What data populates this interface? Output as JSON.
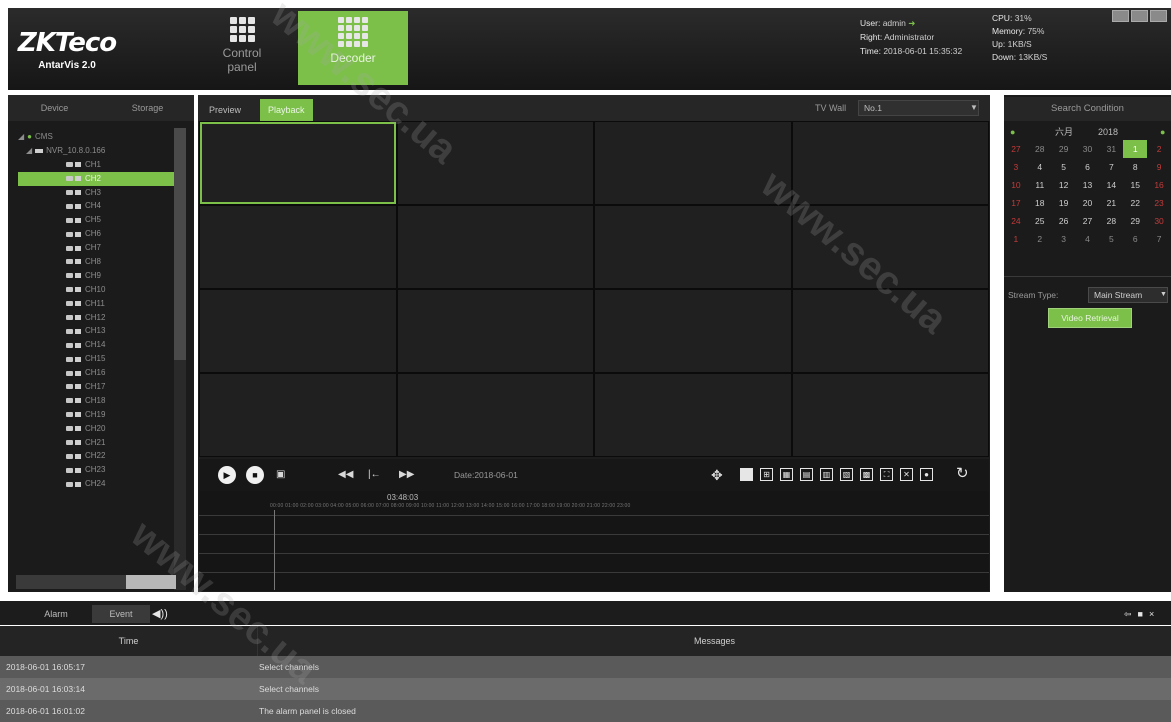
{
  "app": {
    "logo": "ZKTeco",
    "product": "AntarVis 2.0"
  },
  "modules": [
    {
      "label": "Control panel",
      "icon": "control-panel-icon"
    },
    {
      "label": "Decoder",
      "icon": "decoder-icon"
    }
  ],
  "status": {
    "user_label": "User:",
    "user_value": "admin",
    "right_label": "Right:",
    "right_value": "Administrator",
    "time_label": "Time:",
    "time_value": "2018-06-01 15:35:32",
    "cpu_label": "CPU:",
    "cpu_value": "31%",
    "memory_label": "Memory:",
    "memory_value": "75%",
    "up_label": "Up:",
    "up_value": "1KB/S",
    "down_label": "Down:",
    "down_value": "13KB/S"
  },
  "left_panel": {
    "tabs": [
      "Device",
      "Storage"
    ],
    "root": "CMS",
    "nvr": "NVR_10.8.0.166",
    "channels": [
      "CH1",
      "CH2",
      "CH3",
      "CH4",
      "CH5",
      "CH6",
      "CH7",
      "CH8",
      "CH9",
      "CH10",
      "CH11",
      "CH12",
      "CH13",
      "CH14",
      "CH15",
      "CH16",
      "CH17",
      "CH18",
      "CH19",
      "CH20",
      "CH21",
      "CH22",
      "CH23",
      "CH24"
    ],
    "selected_channel": "CH2"
  },
  "center": {
    "tabs": [
      "Preview",
      "Playback"
    ],
    "active_tab": "Playback",
    "tv_wall_label": "TV Wall",
    "tv_wall_value": "No.1",
    "grid_cells": 16
  },
  "playback": {
    "date_label": "Date:2018-06-01",
    "current_time": "03:48:03",
    "ruler": "00:00 01:00 02:00 03:00 04:00 05:00 06:00 07:00 08:00 09:00 10:00 11:00 12:00 13:00 14:00 15:00 16:00 17:00 18:00 19:00 20:00 21:00 22:00 23:00",
    "tracks": 4
  },
  "right_panel": {
    "search_condition": "Search Condition",
    "calendar_month": "六月",
    "calendar_year": "2018",
    "calendar_days": [
      [
        "27",
        "28",
        "29",
        "30",
        "31",
        "1",
        "2"
      ],
      [
        "3",
        "4",
        "5",
        "6",
        "7",
        "8",
        "9"
      ],
      [
        "10",
        "11",
        "12",
        "13",
        "14",
        "15",
        "16"
      ],
      [
        "17",
        "18",
        "19",
        "20",
        "21",
        "22",
        "23"
      ],
      [
        "24",
        "25",
        "26",
        "27",
        "28",
        "29",
        "30"
      ],
      [
        "1",
        "2",
        "3",
        "4",
        "5",
        "6",
        "7"
      ]
    ],
    "selected_day": "1",
    "stream_type_label": "Stream Type:",
    "stream_type_value": "Main Stream",
    "retrieval_button": "Video Retrieval"
  },
  "log": {
    "tabs": [
      "Alarm",
      "Event"
    ],
    "active_tab": "Event",
    "columns": [
      "Time",
      "Messages"
    ],
    "rows": [
      {
        "time": "2018-06-01 16:05:17",
        "message": "Select channels"
      },
      {
        "time": "2018-06-01 16:03:14",
        "message": "Select channels"
      },
      {
        "time": "2018-06-01 16:01:02",
        "message": "The alarm panel is closed"
      }
    ]
  },
  "watermark": "www.sec.ua",
  "colors": {
    "accent": "#7cc04a",
    "background": "#1b1b1b",
    "sunday": "#c23b3b"
  }
}
